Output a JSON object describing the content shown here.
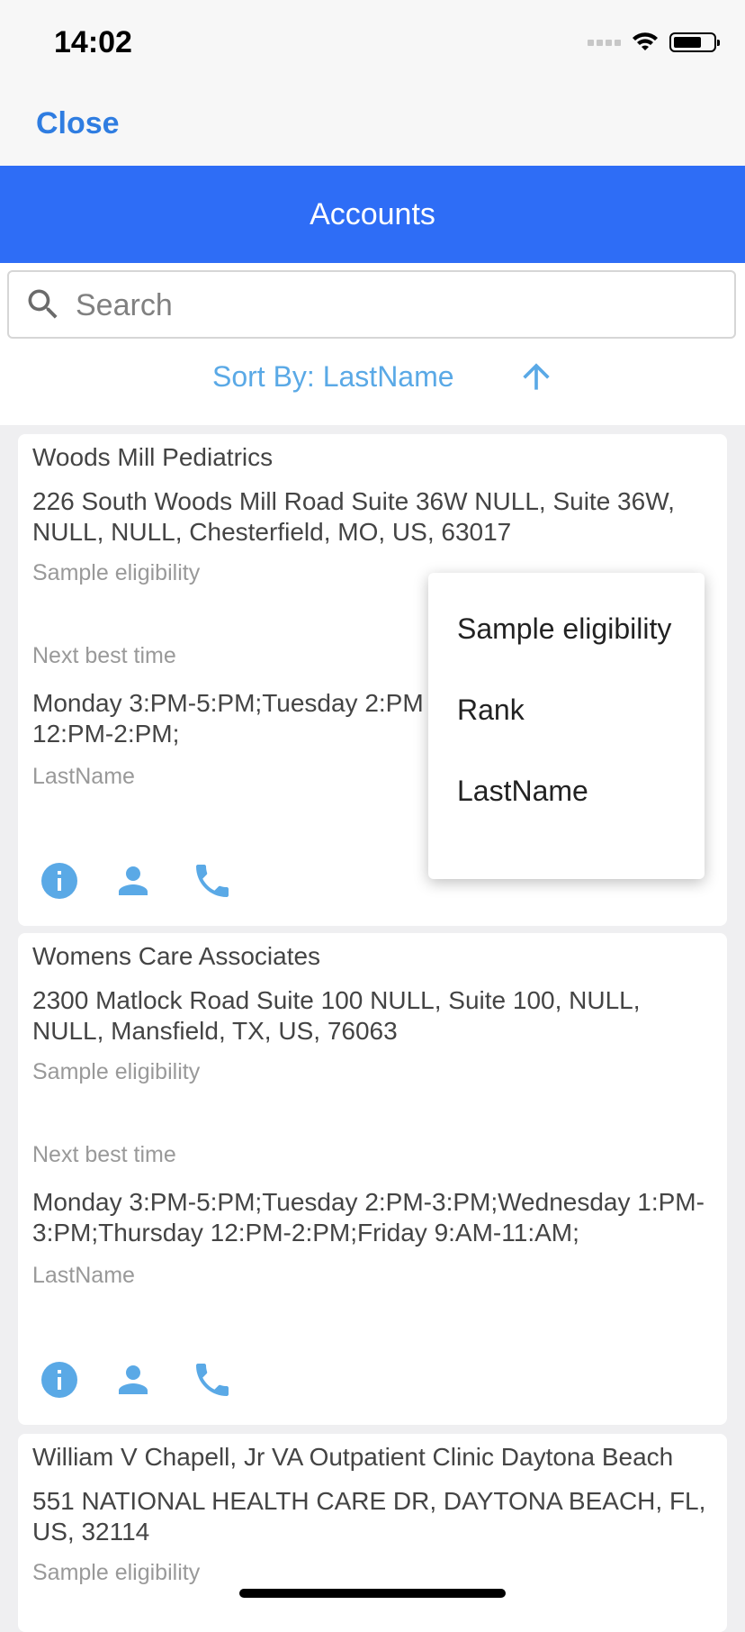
{
  "status_bar": {
    "time": "14:02"
  },
  "nav": {
    "close_label": "Close"
  },
  "header": {
    "title": "Accounts"
  },
  "search": {
    "placeholder": "Search",
    "value": ""
  },
  "sort": {
    "label": "Sort By: LastName"
  },
  "dropdown": {
    "options": [
      "Sample eligibility",
      "Rank",
      "LastName"
    ]
  },
  "accounts": [
    {
      "name": "Woods Mill Pediatrics",
      "address": "226 South Woods Mill Road Suite 36W NULL, Suite 36W, NULL, NULL, Chesterfield, MO, US, 63017",
      "sample_label": "Sample eligibility",
      "next_best_label": "Next best time",
      "next_best_value": "Monday 3:PM-5:PM;Tuesday 2:PM 1:PM-3:PM;Thursday 12:PM-2:PM;",
      "lastname_label": "LastName"
    },
    {
      "name": "Womens Care Associates",
      "address": "2300 Matlock Road Suite 100 NULL, Suite 100, NULL, NULL, Mansfield, TX, US, 76063",
      "sample_label": "Sample eligibility",
      "next_best_label": "Next best time",
      "next_best_value": "Monday 3:PM-5:PM;Tuesday 2:PM-3:PM;Wednesday 1:PM-3:PM;Thursday 12:PM-2:PM;Friday 9:AM-11:AM;",
      "lastname_label": "LastName"
    },
    {
      "name": "William V Chapell, Jr VA Outpatient Clinic Daytona Beach",
      "address": "551 NATIONAL HEALTH CARE DR, DAYTONA BEACH, FL, US, 32114",
      "sample_label": "Sample eligibility"
    }
  ],
  "colors": {
    "primary": "#2e6df6",
    "accent": "#5aa9e6",
    "link": "#2f7de1"
  },
  "icons": {
    "search": "search-icon",
    "sort": "arrow-up-icon",
    "actions": [
      "info-icon",
      "person-icon",
      "phone-icon"
    ]
  }
}
